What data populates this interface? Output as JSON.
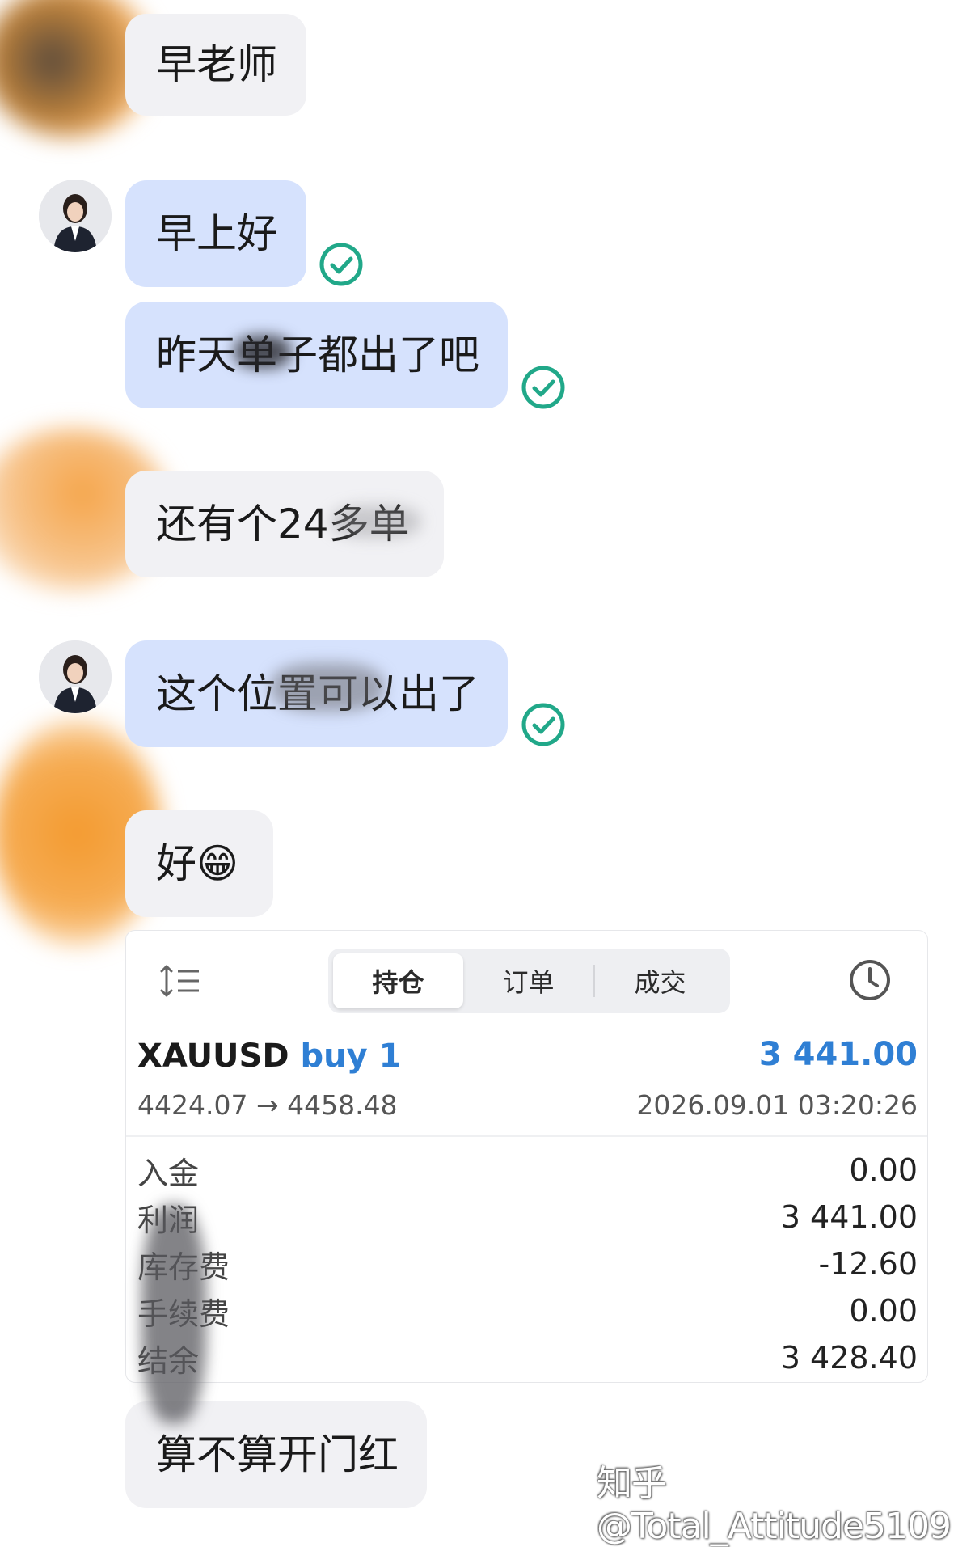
{
  "messages": [
    {
      "from": "other",
      "text": "早老师"
    },
    {
      "from": "me",
      "text": "早上好",
      "read": true
    },
    {
      "from": "me",
      "text": "昨天单子都出了吧",
      "read": true
    },
    {
      "from": "other",
      "text": "还有个24多单"
    },
    {
      "from": "me",
      "text": "这个位置可以出了",
      "read": true
    },
    {
      "from": "other",
      "text": "好😁"
    },
    {
      "from": "other",
      "text": "算不算开门红"
    }
  ],
  "trade_card": {
    "tabs": [
      {
        "label": "持仓",
        "active": true
      },
      {
        "label": "订单",
        "active": false
      },
      {
        "label": "成交",
        "active": false
      }
    ],
    "icons": {
      "left": "sort-list-icon",
      "right": "clock-icon"
    },
    "position": {
      "symbol": "XAUUSD",
      "direction": "buy 1",
      "profit": "3 441.00",
      "prices": "4424.07 → 4458.48",
      "time": "2026.09.01 03:20:26"
    },
    "summary": [
      {
        "label": "入金",
        "value": "0.00"
      },
      {
        "label": "利润",
        "value": "3 441.00"
      },
      {
        "label": "库存费",
        "value": "-12.60"
      },
      {
        "label": "手续费",
        "value": "0.00"
      },
      {
        "label": "结余",
        "value": "3 428.40"
      }
    ]
  },
  "colors": {
    "incoming_bubble": "#f1f1f4",
    "outgoing_bubble": "#d6e2fd",
    "read_check": "#21a889",
    "profit_blue": "#2f7fd4"
  },
  "watermark": "知乎 @Total_Attitude5109"
}
